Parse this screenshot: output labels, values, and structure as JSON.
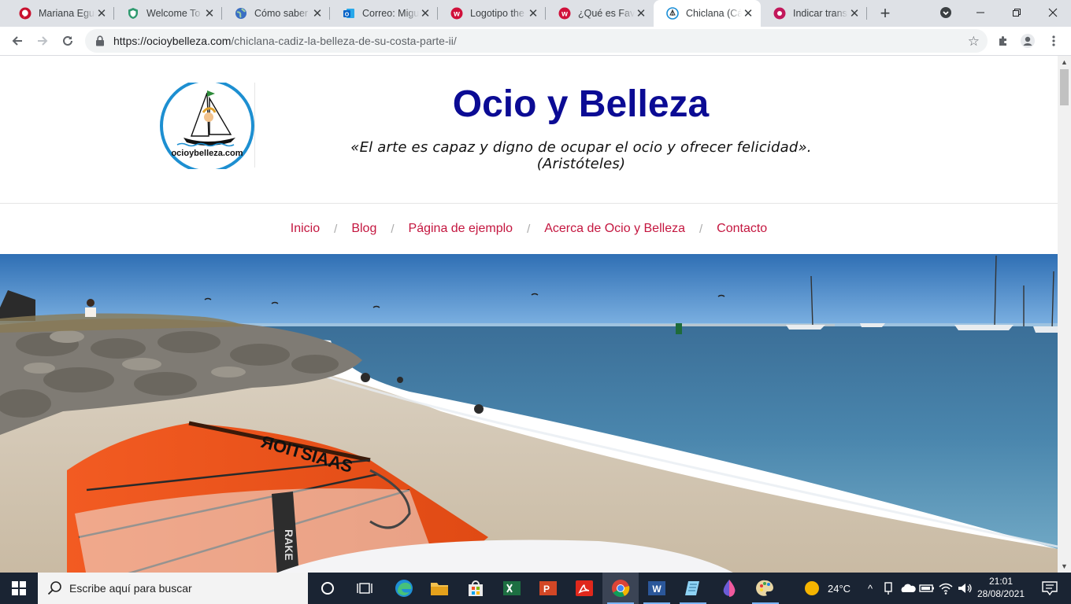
{
  "tabs": [
    {
      "title": "Mariana Egua",
      "favicon": "pinterest-icon",
      "color": "#e60023"
    },
    {
      "title": "Welcome To S",
      "favicon": "shield-icon",
      "color": "#2e9a6f"
    },
    {
      "title": "Cómo saber e",
      "favicon": "globe-icon",
      "color": "#3a6ec3"
    },
    {
      "title": "Correo: Migu",
      "favicon": "outlook-icon",
      "color": "#0a64c7"
    },
    {
      "title": "Logotipo the",
      "favicon": "wix-logo-icon",
      "color": "#d0103a"
    },
    {
      "title": "¿Qué es Favic",
      "favicon": "wix-logo-icon",
      "color": "#d0103a"
    },
    {
      "title": "Chiclana (Cád",
      "favicon": "site-logo-icon",
      "color": "#1a8ed6"
    },
    {
      "title": "Indicar transp",
      "favicon": "app-icon",
      "color": "#c2185b"
    }
  ],
  "active_tab_index": 6,
  "address_bar": {
    "domain": "https://ocioybelleza.com",
    "path": "/chiclana-cadiz-la-belleza-de-su-costa-parte-ii/"
  },
  "site": {
    "logo_text": "ocioybelleza.com",
    "title": "Ocio y Belleza",
    "description": "«El arte es capaz y digno de ocupar el ocio y ofrecer felicidad». (Aristóteles)"
  },
  "nav": {
    "separator": "/",
    "items": [
      "Inicio",
      "Blog",
      "Página de ejemplo",
      "Acerca de Ocio y Belleza",
      "Contacto"
    ]
  },
  "hero": {
    "sail_brand": "ЯOITSIAAS",
    "board_brand": "RAKE",
    "alt": "Playa de Chiclana con vela de windsurf"
  },
  "taskbar": {
    "search_placeholder": "Escribe aquí para buscar",
    "weather": "24°C",
    "time": "21:01",
    "date": "28/08/2021"
  },
  "colors": {
    "title": "#0b0b94",
    "nav_link": "#c4163f",
    "taskbar": "#1a2433"
  }
}
